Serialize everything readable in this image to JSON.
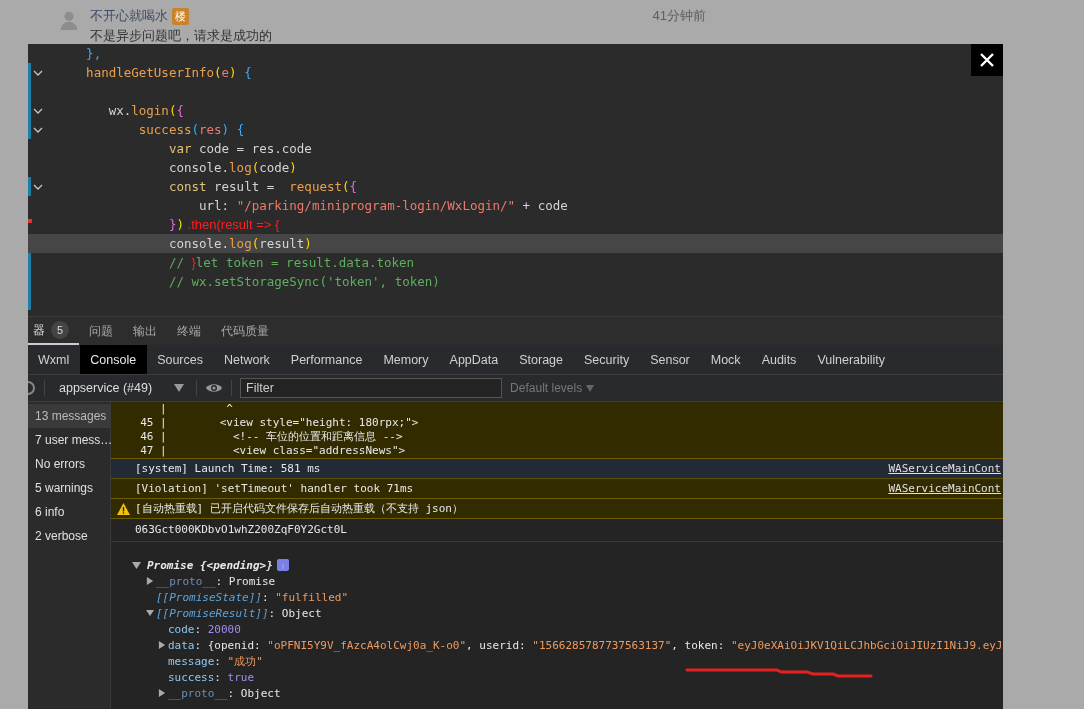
{
  "comment": {
    "author": "不开心就喝水",
    "badge": "楼",
    "time": "41分钟前",
    "text": "不是异步问题吧，请求是成功的"
  },
  "editor": {
    "lines": [
      {
        "fold": false,
        "modified": false,
        "removed": false,
        "highlight": false,
        "tokens": [
          {
            "kind": "brace3",
            "text": "    },"
          }
        ]
      },
      {
        "fold": true,
        "modified": true,
        "removed": false,
        "highlight": false,
        "tokens": [
          {
            "kind": "func",
            "text": "    handleGetUserInfo"
          },
          {
            "kind": "brace1",
            "text": "("
          },
          {
            "kind": "param",
            "text": "e"
          },
          {
            "kind": "brace1",
            "text": ")"
          },
          {
            "kind": "brace3",
            "text": " {"
          }
        ]
      },
      {
        "fold": false,
        "modified": true,
        "removed": false,
        "highlight": false
      },
      {
        "fold": true,
        "modified": true,
        "removed": false,
        "highlight": false,
        "tokens": [
          {
            "kind": "plain",
            "text": "       wx."
          },
          {
            "kind": "func",
            "text": "login"
          },
          {
            "kind": "brace1",
            "text": "("
          },
          {
            "kind": "brace2",
            "text": "{"
          }
        ]
      },
      {
        "fold": true,
        "modified": true,
        "removed": false,
        "highlight": false,
        "tokens": [
          {
            "kind": "func",
            "text": "           success"
          },
          {
            "kind": "brace3",
            "text": "("
          },
          {
            "kind": "param",
            "text": "res"
          },
          {
            "kind": "brace3",
            "text": ")"
          },
          {
            "kind": "brace3",
            "text": " {"
          }
        ]
      },
      {
        "fold": false,
        "modified": false,
        "removed": false,
        "highlight": false,
        "tokens": [
          {
            "kind": "keyword",
            "text": "               var"
          },
          {
            "kind": "plain",
            "text": " code = res.code"
          }
        ]
      },
      {
        "fold": false,
        "modified": false,
        "removed": false,
        "highlight": false,
        "tokens": [
          {
            "kind": "plain",
            "text": "               console."
          },
          {
            "kind": "func",
            "text": "log"
          },
          {
            "kind": "brace1",
            "text": "("
          },
          {
            "kind": "plain",
            "text": "code"
          },
          {
            "kind": "brace1",
            "text": ")"
          }
        ]
      },
      {
        "fold": true,
        "modified": true,
        "removed": false,
        "highlight": false,
        "tokens": [
          {
            "kind": "keyword",
            "text": "               const"
          },
          {
            "kind": "plain",
            "text": " result =  "
          },
          {
            "kind": "func",
            "text": "request"
          },
          {
            "kind": "brace1",
            "text": "("
          },
          {
            "kind": "brace2",
            "text": "{"
          }
        ]
      },
      {
        "fold": false,
        "modified": false,
        "removed": false,
        "highlight": false,
        "tokens": [
          {
            "kind": "plain",
            "text": "                   url: "
          },
          {
            "kind": "string",
            "text": "\"/parking/miniprogram-login/WxLogin/\""
          },
          {
            "kind": "plain",
            "text": " + code"
          }
        ]
      },
      {
        "fold": false,
        "modified": false,
        "removed": true,
        "highlight": false,
        "tokens": [
          {
            "kind": "brace2",
            "text": "               }"
          },
          {
            "kind": "brace1",
            "text": ")"
          },
          {
            "kind": "annotation",
            "text": " .then(result => {"
          }
        ]
      },
      {
        "fold": false,
        "modified": false,
        "removed": false,
        "highlight": true,
        "tokens": [
          {
            "kind": "plain",
            "text": "               console."
          },
          {
            "kind": "func",
            "text": "log"
          },
          {
            "kind": "brace1",
            "text": "("
          },
          {
            "kind": "plain",
            "text": "result"
          },
          {
            "kind": "brace1",
            "text": ")"
          }
        ]
      },
      {
        "fold": false,
        "modified": true,
        "removed": false,
        "highlight": false,
        "tokens": [
          {
            "kind": "comment",
            "text": "               // "
          },
          {
            "kind": "annotation",
            "text": "}"
          },
          {
            "kind": "comment",
            "text": "let token = result.data.token"
          }
        ]
      },
      {
        "fold": false,
        "modified": true,
        "removed": false,
        "highlight": false,
        "tokens": [
          {
            "kind": "comment",
            "text": "               // wx.setStorageSync('token', token)"
          }
        ]
      },
      {
        "fold": false,
        "modified": true,
        "removed": false,
        "highlight": false
      }
    ]
  },
  "panel_tabs": [
    {
      "label": "器",
      "badge": "5",
      "selected": true
    },
    {
      "label": "问题",
      "selected": false
    },
    {
      "label": "输出",
      "selected": false
    },
    {
      "label": "终端",
      "selected": false
    },
    {
      "label": "代码质量",
      "selected": false
    }
  ],
  "devtools_tabs": [
    {
      "label": "Wxml",
      "selected": false
    },
    {
      "label": "Console",
      "selected": true
    },
    {
      "label": "Sources",
      "selected": false
    },
    {
      "label": "Network",
      "selected": false
    },
    {
      "label": "Performance",
      "selected": false
    },
    {
      "label": "Memory",
      "selected": false
    },
    {
      "label": "AppData",
      "selected": false
    },
    {
      "label": "Storage",
      "selected": false
    },
    {
      "label": "Security",
      "selected": false
    },
    {
      "label": "Sensor",
      "selected": false
    },
    {
      "label": "Mock",
      "selected": false
    },
    {
      "label": "Audits",
      "selected": false
    },
    {
      "label": "Vulnerability",
      "selected": false
    }
  ],
  "toolbar": {
    "context": "appservice (#49)",
    "filter_placeholder": "Filter",
    "levels": "Default levels"
  },
  "sidebar": [
    {
      "label": "13 messages",
      "selected": true
    },
    {
      "label": "7 user mess…",
      "selected": false
    },
    {
      "label": "No errors",
      "selected": false
    },
    {
      "label": "5 warnings",
      "selected": false
    },
    {
      "label": "6 info",
      "selected": false
    },
    {
      "label": "2 verbose",
      "selected": false
    }
  ],
  "messages": [
    {
      "kind": "codeframe",
      "rows": [
        "     |         ^",
        "  45 |        <view style=\"height: 180rpx;\">",
        "  46 |          <!-- 车位的位置和距离信息 -->",
        "  47 |          <view class=\"addressNews\">"
      ]
    },
    {
      "kind": "system",
      "text": "[system] Launch Time: 581 ms",
      "source": "WAServiceMainCont"
    },
    {
      "kind": "violation",
      "text": "[Violation] 'setTimeout' handler took 71ms",
      "source": "WAServiceMainCont"
    },
    {
      "kind": "warning",
      "text": "[自动热重载] 已开启代码文件保存后自动热重载（不支持 json）"
    },
    {
      "kind": "log",
      "text": "063Gct000KDbvO1whZ200ZqF0Y2Gct0L"
    },
    {
      "kind": "object",
      "title": "Promise {<pending>}",
      "expanded": true,
      "children": [
        {
          "key": "__proto__",
          "kind": "proto",
          "expanded": false,
          "value": [
            {
              "kind": "plain",
              "text": ": Promise"
            }
          ]
        },
        {
          "key": "[[PromiseState]]",
          "kind": "internal",
          "value": [
            {
              "kind": "plain",
              "text": ": "
            },
            {
              "kind": "string",
              "text": "\"fulfilled\""
            }
          ]
        },
        {
          "key": "[[PromiseResult]]",
          "kind": "internal",
          "expanded": true,
          "value": [
            {
              "kind": "plain",
              "text": ": Object"
            }
          ],
          "children": [
            {
              "key": "code",
              "kind": "prop",
              "value": [
                {
                  "kind": "plain",
                  "text": ": "
                },
                {
                  "kind": "number",
                  "text": "20000"
                }
              ]
            },
            {
              "key": "data",
              "kind": "prop",
              "expanded": false,
              "value": [
                {
                  "kind": "plain",
                  "text": ": {openid: "
                },
                {
                  "kind": "string",
                  "text": "\"oPFNI5Y9V_fAzcA4olCwj0a_K-o0\""
                },
                {
                  "kind": "plain",
                  "text": ", userid: "
                },
                {
                  "kind": "string",
                  "text": "\"1566285787737563137\""
                },
                {
                  "kind": "plain",
                  "text": ", token: "
                },
                {
                  "kind": "string",
                  "text": "\"eyJ0eXAiOiJKV1QiLCJhbGciOiJIUzI1NiJ9.eyJ"
                }
              ]
            },
            {
              "key": "message",
              "kind": "prop",
              "value": [
                {
                  "kind": "plain",
                  "text": ": "
                },
                {
                  "kind": "string",
                  "text": "\"成功\""
                }
              ]
            },
            {
              "key": "success",
              "kind": "prop",
              "value": [
                {
                  "kind": "plain",
                  "text": ": "
                },
                {
                  "kind": "number",
                  "text": "true"
                }
              ]
            },
            {
              "key": "__proto__",
              "kind": "proto",
              "expanded": false,
              "value": [
                {
                  "kind": "plain",
                  "text": ": Object"
                }
              ]
            }
          ]
        }
      ]
    }
  ]
}
